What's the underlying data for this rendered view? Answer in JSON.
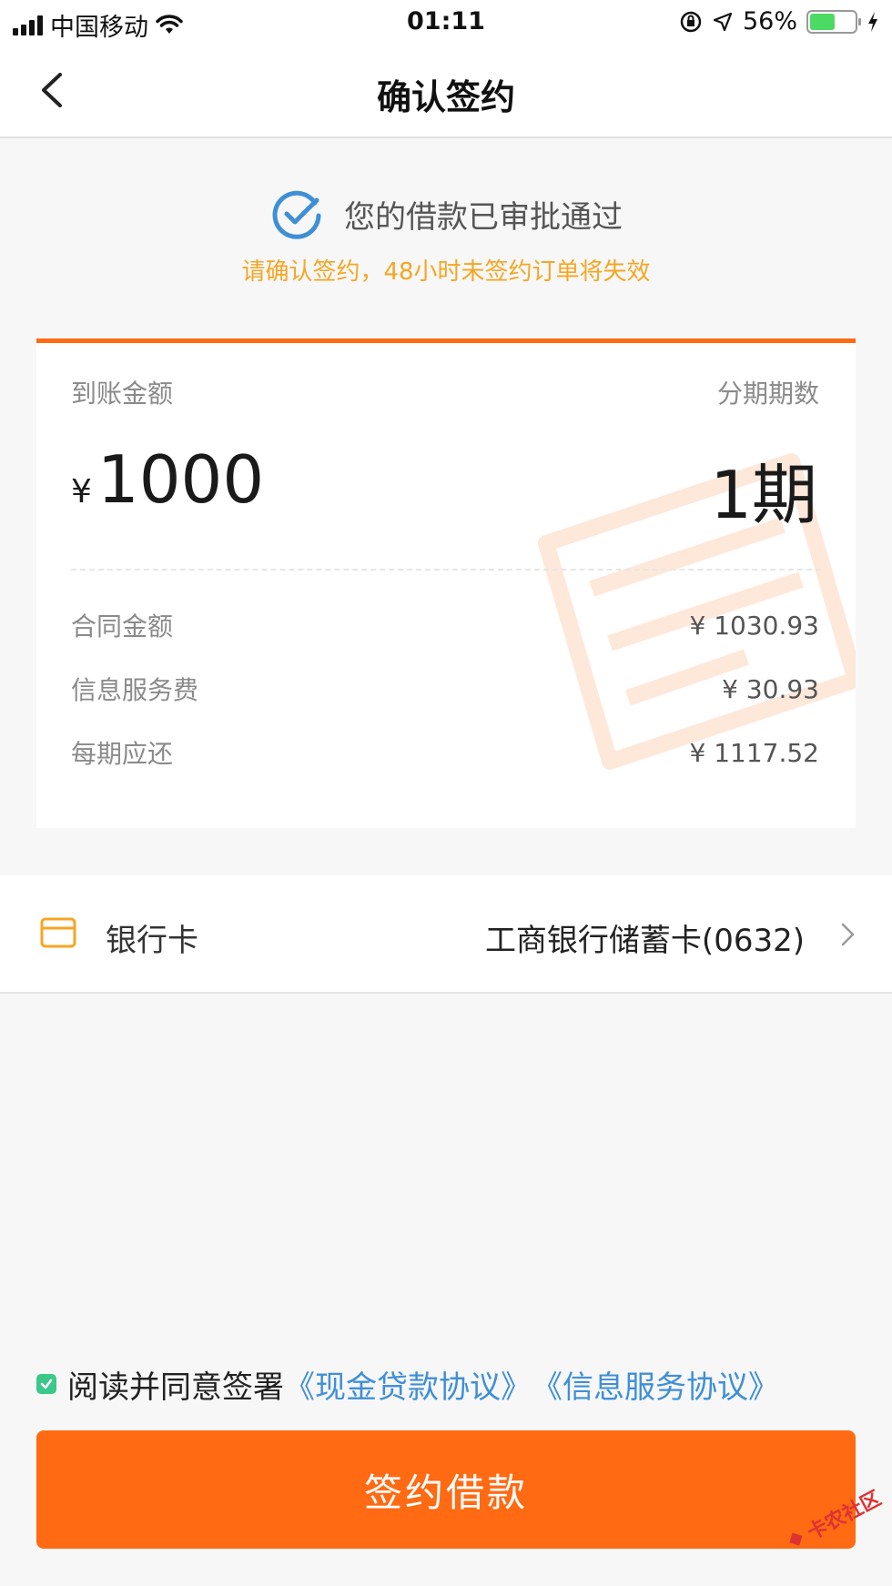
{
  "status_bar": {
    "carrier": "中国移动",
    "time": "01:11",
    "battery": "56%",
    "battery_level": 0.56
  },
  "nav": {
    "title": "确认签约"
  },
  "approval": {
    "message": "您的借款已审批通过",
    "notice": "请确认签约，48小时未签约订单将失效"
  },
  "loan_card": {
    "amount_label": "到账金额",
    "currency": "¥",
    "amount": "1000",
    "periods_label": "分期期数",
    "periods": "1期",
    "details": [
      {
        "label": "合同金额",
        "value": "¥ 1030.93"
      },
      {
        "label": "信息服务费",
        "value": "¥ 30.93"
      },
      {
        "label": "每期应还",
        "value": "¥ 1117.52"
      }
    ]
  },
  "bank": {
    "label": "银行卡",
    "value": "工商银行储蓄卡(0632)"
  },
  "agreement": {
    "prefix": "阅读并同意签署",
    "link1": "《现金贷款协议》",
    "link2": "《信息服务协议》",
    "checked": true
  },
  "submit": {
    "label": "签约借款"
  },
  "corner_logo": {
    "text": "卡农社区"
  },
  "colors": {
    "accent": "#ff6a13",
    "notice": "#f5a623",
    "link": "#3f8fd6",
    "check": "#3cc88a"
  }
}
